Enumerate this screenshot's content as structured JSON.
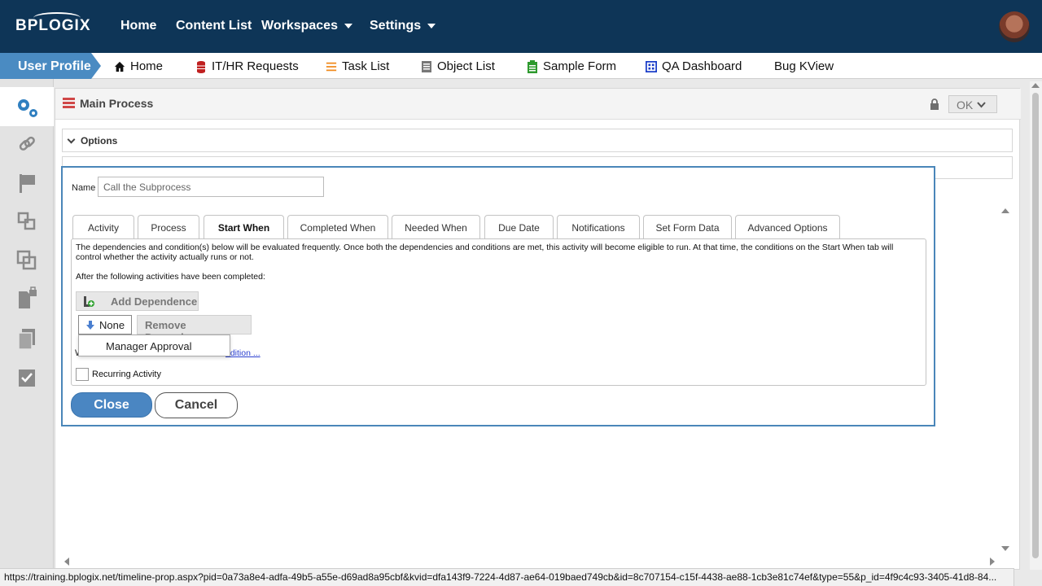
{
  "header": {
    "logo_text": "BPLOGIX",
    "nav": [
      {
        "label": "Home"
      },
      {
        "label": "Content List"
      },
      {
        "label": "Workspaces"
      },
      {
        "label": "Settings"
      }
    ]
  },
  "subnav": {
    "active_tab": "User Profile",
    "items": [
      {
        "label": "Home",
        "icon": "home-icon"
      },
      {
        "label": "IT/HR Requests",
        "icon": "database-icon"
      },
      {
        "label": "Task List",
        "icon": "list-icon"
      },
      {
        "label": "Object List",
        "icon": "document-icon"
      },
      {
        "label": "Sample Form",
        "icon": "form-icon"
      },
      {
        "label": "QA Dashboard",
        "icon": "dashboard-icon"
      },
      {
        "label": "Bug KView",
        "icon": ""
      }
    ]
  },
  "sidebar": {
    "items": [
      "gears-icon",
      "link-icon",
      "flag-icon",
      "subprocess-icon",
      "copy-icon",
      "locked-doc-icon",
      "pages-icon",
      "checklist-icon"
    ]
  },
  "main": {
    "title": "Main Process",
    "ok_label": "OK",
    "options_label": "Options"
  },
  "dialog": {
    "name_label": "Name",
    "name_value": "Call the Subprocess",
    "tabs": [
      {
        "label": "Activity"
      },
      {
        "label": "Process"
      },
      {
        "label": "Start When"
      },
      {
        "label": "Completed When"
      },
      {
        "label": "Needed When"
      },
      {
        "label": "Due Date"
      },
      {
        "label": "Notifications"
      },
      {
        "label": "Set Form Data"
      },
      {
        "label": "Advanced Options"
      }
    ],
    "active_tab": "Start When",
    "description": "The dependencies and condition(s) below will be evaluated frequently. Once both the dependencies and conditions are met, this activity will become eligible to run. At that time, the conditions on the Start When tab will control whether the activity actually runs or not.",
    "after_text": "After the following activities have been completed:",
    "add_dependence_label": "Add Dependence",
    "dependence_selected": "None",
    "remove_dependence_label": "Remove Dependence",
    "dropdown_option": "Manager Approval",
    "w_text": "W",
    "condition_link": "ndition ...",
    "recurring_label": "Recurring Activity",
    "close_label": "Close",
    "cancel_label": "Cancel"
  },
  "status_url": "https://training.bplogix.net/timeline-prop.aspx?pid=0a73a8e4-adfa-49b5-a55e-d69ad8a95cbf&kvid=dfa143f9-7224-4d87-ae64-019baed749cb&id=8c707154-c15f-4438-ae88-1cb3e81c74ef&type=55&p_id=4f9c4c93-3405-41d8-84...",
  "colors": {
    "header_bg": "#0e3557",
    "accent": "#4a8bc2",
    "dialog_border": "#4a86b9"
  }
}
